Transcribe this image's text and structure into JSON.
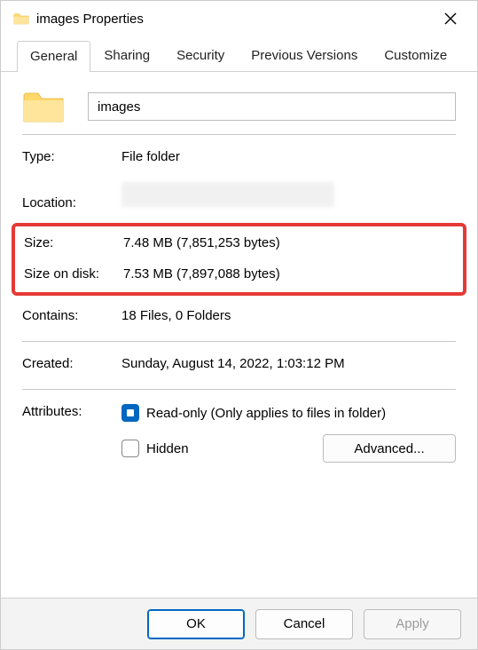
{
  "window": {
    "title": "images Properties"
  },
  "tabs": {
    "general": "General",
    "sharing": "Sharing",
    "security": "Security",
    "previous": "Previous Versions",
    "customize": "Customize"
  },
  "general": {
    "name_value": "images",
    "type_label": "Type:",
    "type_value": "File folder",
    "location_label": "Location:",
    "size_label": "Size:",
    "size_value": "7.48 MB (7,851,253 bytes)",
    "size_on_disk_label": "Size on disk:",
    "size_on_disk_value": "7.53 MB (7,897,088 bytes)",
    "contains_label": "Contains:",
    "contains_value": "18 Files, 0 Folders",
    "created_label": "Created:",
    "created_value": "Sunday, August 14, 2022, 1:03:12 PM",
    "attributes_label": "Attributes:",
    "readonly_label": "Read-only (Only applies to files in folder)",
    "hidden_label": "Hidden",
    "advanced_button": "Advanced..."
  },
  "footer": {
    "ok": "OK",
    "cancel": "Cancel",
    "apply": "Apply"
  }
}
